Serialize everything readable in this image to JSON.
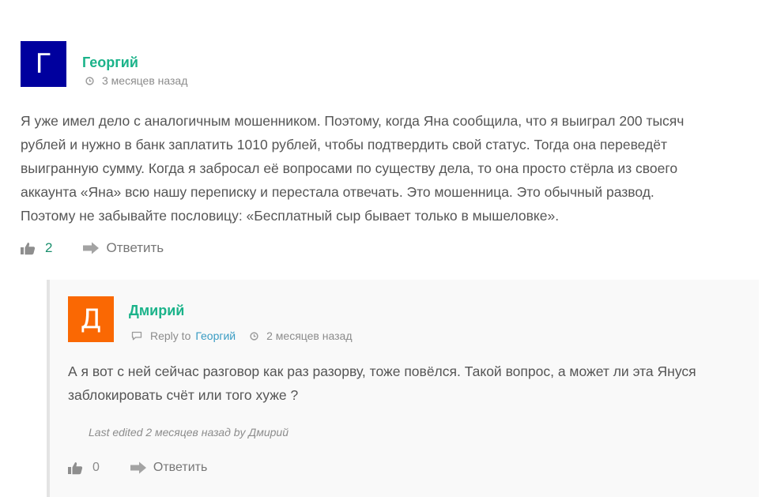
{
  "comment": {
    "avatar_letter": "Г",
    "author": "Георгий",
    "time": "3 месяцев назад",
    "text_lines": [
      "Я уже имел дело с аналогичным мошенником. Поэтому, когда Яна сообщила, что я выиграл 200 тысяч",
      "рублей и нужно в банк заплатить 1010 рублей, чтобы подтвердить свой статус. Тогда она переведёт",
      "выигранную сумму. Когда я забросал её вопросами по существу дела, то она просто стёрла из своего",
      "аккаунта «Яна» всю нашу переписку и перестала отвечать. Это мошенница. Это обычный развод.",
      "Поэтому не забывайте пословицу: «Бесплатный сыр бывает только в мышеловке»."
    ],
    "likes": "2",
    "reply_label": "Ответить"
  },
  "reply": {
    "avatar_letter": "Д",
    "author": "Дмирий",
    "reply_to_label": "Reply to",
    "reply_to_name": "Георгий",
    "time": "2 месяцев назад",
    "text_lines": [
      "А я вот с ней сейчас разговор как раз разорву, тоже повёлся. Такой вопрос, а может ли эта Януся",
      "заблокировать счёт или того хуже ?"
    ],
    "edited": "Last edited 2 месяцев назад by Дмирий",
    "likes": "0",
    "reply_label": "Ответить"
  },
  "colors": {
    "author": "#1bb38a",
    "avatar_main": "#00009e",
    "avatar_reply": "#fa6803",
    "link": "#3a9cc3"
  },
  "icons": [
    "clock-icon",
    "thumbs-up-icon",
    "reply-arrow-icon",
    "speech-bubble-icon"
  ]
}
